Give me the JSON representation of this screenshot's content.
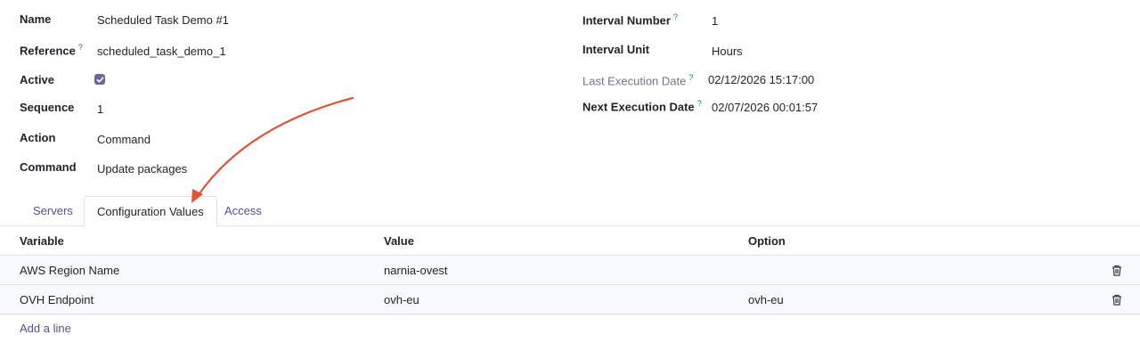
{
  "form": {
    "left": {
      "name_label": "Name",
      "name_value": "Scheduled Task Demo #1",
      "reference_label": "Reference",
      "reference_help": "?",
      "reference_value": "scheduled_task_demo_1",
      "active_label": "Active",
      "sequence_label": "Sequence",
      "sequence_value": "1",
      "action_label": "Action",
      "action_value": "Command",
      "command_label": "Command",
      "command_value": "Update packages"
    },
    "right": {
      "interval_number_label": "Interval Number",
      "interval_number_help": "?",
      "interval_number_value": "1",
      "interval_unit_label": "Interval Unit",
      "interval_unit_value": "Hours",
      "last_exec_label": "Last Execution Date",
      "last_exec_help": "?",
      "last_exec_value": "02/12/2026 15:17:00",
      "next_exec_label": "Next Execution Date",
      "next_exec_help": "?",
      "next_exec_value": "02/07/2026 00:01:57"
    }
  },
  "tabs": [
    "Servers",
    "Configuration Values",
    "Access"
  ],
  "table": {
    "headers": [
      "Variable",
      "Value",
      "Option"
    ],
    "rows": [
      [
        "AWS Region Name",
        "narnia-ovest",
        ""
      ],
      [
        "OVH Endpoint",
        "ovh-eu",
        "ovh-eu"
      ]
    ],
    "add_line": "Add a line"
  },
  "colors": {
    "accent": "#71639e",
    "link": "#5b4e8a",
    "help": "#017e84",
    "annotation_arrow": "#e0533a"
  },
  "icons": {
    "checkbox": "check-icon",
    "delete": "trash-icon"
  }
}
